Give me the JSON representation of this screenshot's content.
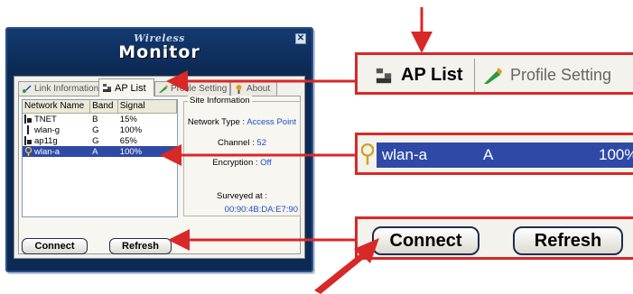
{
  "window": {
    "title_top": "Wireless",
    "title_main": "Monitor",
    "close_glyph": "✕"
  },
  "tabs": [
    {
      "label": "Link Information",
      "icon": "link-info-icon"
    },
    {
      "label": "AP List",
      "icon": "ap-list-icon"
    },
    {
      "label": "Profile Setting",
      "icon": "profile-setting-icon"
    },
    {
      "label": "About",
      "icon": "about-icon"
    }
  ],
  "ap_list": {
    "headers": [
      "Network Name",
      "Band",
      "Signal"
    ],
    "rows": [
      {
        "name": "TNET",
        "band": "B",
        "signal": "15%",
        "icon": "secured-ap-icon"
      },
      {
        "name": "wlan-g",
        "band": "G",
        "signal": "100%",
        "icon": "ap-icon"
      },
      {
        "name": "ap11g",
        "band": "G",
        "signal": "65%",
        "icon": "secured-ap-icon"
      },
      {
        "name": "wlan-a",
        "band": "A",
        "signal": "100%",
        "icon": "connected-ap-icon",
        "selected": true
      }
    ]
  },
  "site_info": {
    "legend": "Site Information",
    "network_type_label": "Network Type :",
    "network_type_value": "Access Point",
    "channel_label": "Channel :",
    "channel_value": "52",
    "encryption_label": "Encryption :",
    "encryption_value": "Off",
    "surveyed_label": "Surveyed at :",
    "surveyed_value": "00:90:4B:DA:E7:90"
  },
  "buttons": {
    "connect": "Connect",
    "refresh": "Refresh"
  },
  "zoom": {
    "tab_ap_list": "AP List",
    "tab_profile": "Profile Setting",
    "row_name": "wlan-a",
    "row_band": "A",
    "row_signal": "100%",
    "connect": "Connect",
    "refresh": "Refresh"
  },
  "colors": {
    "callout_red": "#d82828",
    "selection_blue": "#2f4aa6",
    "window_navy": "#0d2a55"
  }
}
